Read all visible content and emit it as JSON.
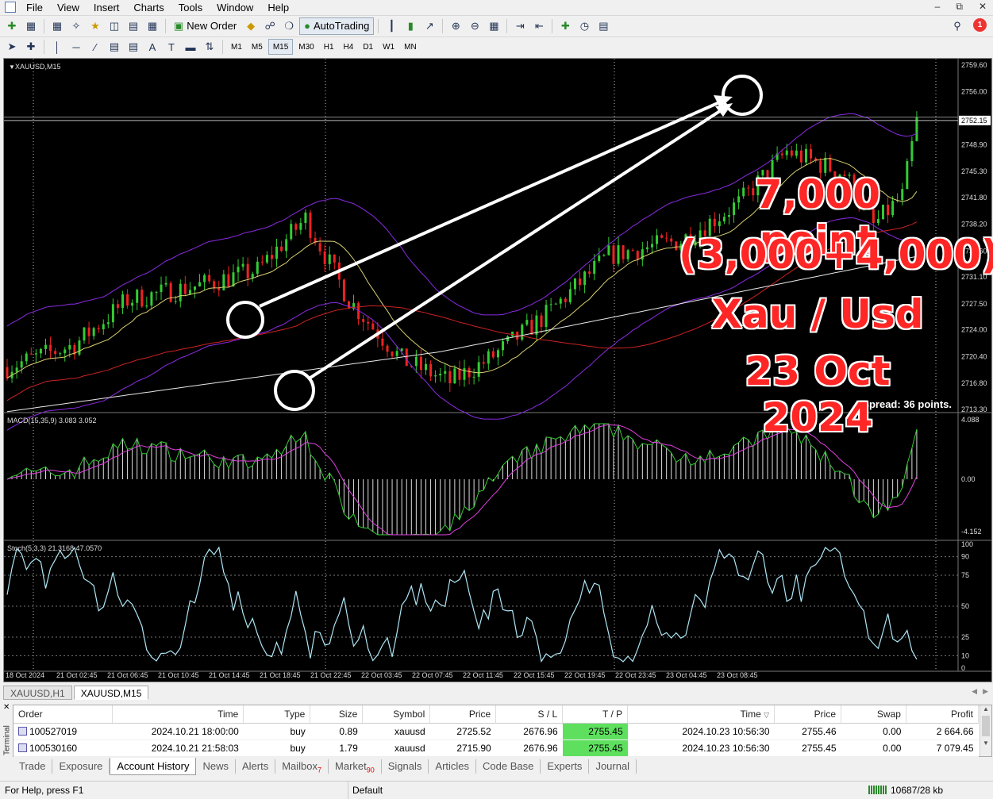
{
  "menu": [
    "File",
    "View",
    "Insert",
    "Charts",
    "Tools",
    "Window",
    "Help"
  ],
  "toolbar": {
    "new_order": "New Order",
    "autotrading": "AutoTrading"
  },
  "timeframes": [
    "M1",
    "M5",
    "M15",
    "M30",
    "H1",
    "H4",
    "D1",
    "W1",
    "MN"
  ],
  "active_timeframe": "M15",
  "notification_count": "1",
  "chart": {
    "symbol_label": "XAUUSD,M15",
    "current_price": "2752.15",
    "spread": "Spread: 36 points.",
    "macd_label": "MACD(15,35,9) 3.083 3.052",
    "stoch_label": "Stoch(5,3,3) 21.3168 47.0570",
    "price_axis": [
      "2759.60",
      "2756.00",
      "2752.15",
      "2748.90",
      "2745.30",
      "2741.80",
      "2738.20",
      "2734.60",
      "2731.10",
      "2727.50",
      "2724.00",
      "2720.40",
      "2716.80",
      "2713.30"
    ],
    "macd_axis": [
      "4.088",
      "0.00",
      "-4.152"
    ],
    "stoch_axis": [
      "100",
      "90",
      "75",
      "50",
      "25",
      "10",
      "0"
    ],
    "time_axis": [
      "18 Oct 2024",
      "21 Oct 02:45",
      "21 Oct 06:45",
      "21 Oct 10:45",
      "21 Oct 14:45",
      "21 Oct 18:45",
      "21 Oct 22:45",
      "22 Oct 03:45",
      "22 Oct 07:45",
      "22 Oct 11:45",
      "22 Oct 15:45",
      "22 Oct 19:45",
      "22 Oct 23:45",
      "23 Oct 04:45",
      "23 Oct 08:45"
    ],
    "annotation": [
      "7,000 point",
      "(3,000+4,000)",
      "Xau / Usd",
      "23 Oct 2024"
    ],
    "colors": {
      "bull": "#33cc33",
      "bear": "#ee2222",
      "band": "#8a2be2",
      "ma_red": "#cc2222",
      "ma_white": "#e8e8e8",
      "stoch": "#aee6f5"
    }
  },
  "chart_tabs": [
    "XAUUSD,H1",
    "XAUUSD,M15"
  ],
  "active_chart_tab": "XAUUSD,M15",
  "terminal": {
    "side_label": "Terminal",
    "columns": [
      "Order",
      "Time",
      "Type",
      "Size",
      "Symbol",
      "Price",
      "S / L",
      "T / P",
      "Time",
      "Price",
      "Swap",
      "Profit"
    ],
    "rows": [
      [
        "100527019",
        "2024.10.21 18:00:00",
        "buy",
        "0.89",
        "xauusd",
        "2725.52",
        "2676.96",
        "2755.45",
        "2024.10.23 10:56:30",
        "2755.46",
        "0.00",
        "2 664.66"
      ],
      [
        "100530160",
        "2024.10.21 21:58:03",
        "buy",
        "1.79",
        "xauusd",
        "2715.90",
        "2676.96",
        "2755.45",
        "2024.10.23 10:56:30",
        "2755.45",
        "0.00",
        "7 079.45"
      ]
    ]
  },
  "terminal_tabs": [
    {
      "label": "Trade",
      "badge": ""
    },
    {
      "label": "Exposure",
      "badge": ""
    },
    {
      "label": "Account History",
      "badge": ""
    },
    {
      "label": "News",
      "badge": ""
    },
    {
      "label": "Alerts",
      "badge": ""
    },
    {
      "label": "Mailbox",
      "badge": "7"
    },
    {
      "label": "Market",
      "badge": "90"
    },
    {
      "label": "Signals",
      "badge": ""
    },
    {
      "label": "Articles",
      "badge": ""
    },
    {
      "label": "Code Base",
      "badge": ""
    },
    {
      "label": "Experts",
      "badge": ""
    },
    {
      "label": "Journal",
      "badge": ""
    }
  ],
  "active_terminal_tab": "Account History",
  "status": {
    "help": "For Help, press F1",
    "profile": "Default",
    "traffic": "10687/28 kb"
  }
}
